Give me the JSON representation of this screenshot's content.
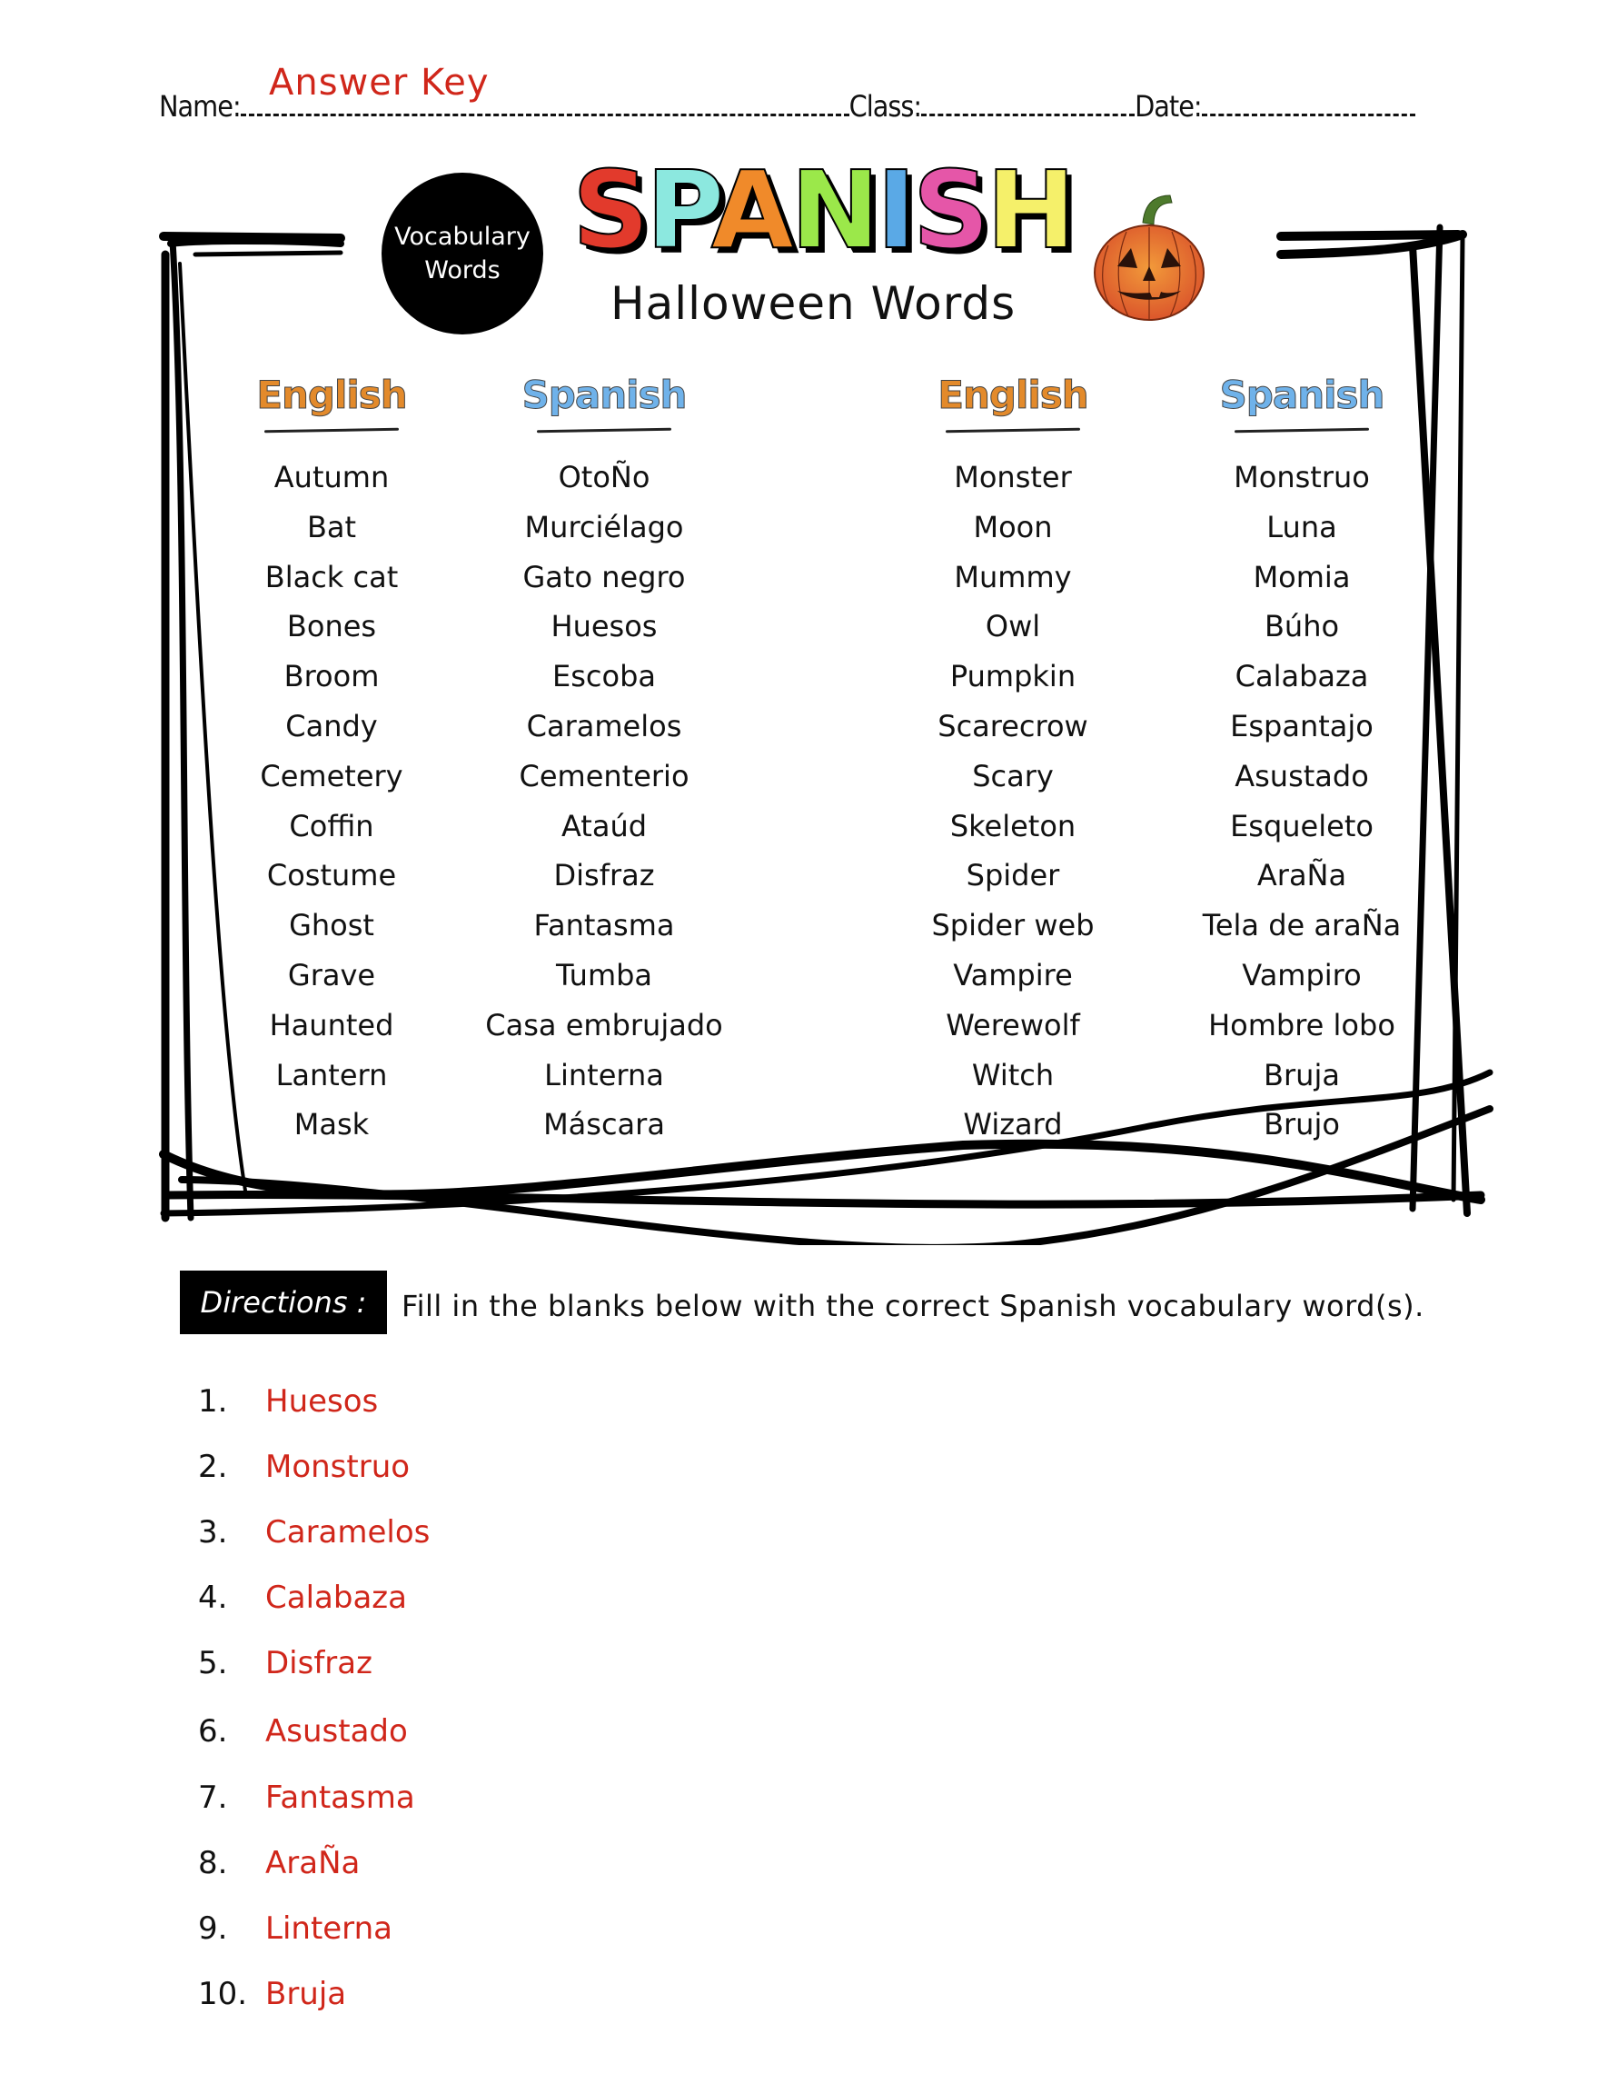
{
  "header": {
    "name_label": "Name:",
    "class_label": "Class:",
    "date_label": "Date:",
    "answer_key": "Answer Key"
  },
  "title": {
    "badge_line1": "Vocabulary",
    "badge_line2": "Words",
    "main_letters": [
      "S",
      "P",
      "A",
      "N",
      "I",
      "S",
      "H"
    ],
    "main_letter_colors": [
      "#e23a2c",
      "#8ce8df",
      "#f08a2a",
      "#9be84a",
      "#5aa9e6",
      "#e556a8",
      "#f5f06a"
    ],
    "subtitle": "Halloween Words",
    "pumpkin_icon": "jack-o-lantern-icon"
  },
  "vocabulary": {
    "headers": {
      "english": "English",
      "spanish": "Spanish"
    },
    "header_colors": {
      "english": "#e38a2b",
      "spanish": "#6fb2ea"
    },
    "left": {
      "english": [
        "Autumn",
        "Bat",
        "Black cat",
        "Bones",
        "Broom",
        "Candy",
        "Cemetery",
        "Coffin",
        "Costume",
        "Ghost",
        "Grave",
        "Haunted",
        "Lantern",
        "Mask"
      ],
      "spanish": [
        "OtoÑo",
        "Murciélago",
        "Gato negro",
        "Huesos",
        "Escoba",
        "Caramelos",
        "Cementerio",
        "Ataúd",
        "Disfraz",
        "Fantasma",
        "Tumba",
        "Casa embrujado",
        "Linterna",
        "Máscara"
      ]
    },
    "right": {
      "english": [
        "Monster",
        "Moon",
        "Mummy",
        "Owl",
        "Pumpkin",
        "Scarecrow",
        "Scary",
        "Skeleton",
        "Spider",
        "Spider web",
        "Vampire",
        "Werewolf",
        "Witch",
        "Wizard"
      ],
      "spanish": [
        "Monstruo",
        "Luna",
        "Momia",
        "Búho",
        "Calabaza",
        "Espantajo",
        "Asustado",
        "Esqueleto",
        "AraÑa",
        "Tela de araÑa",
        "Vampiro",
        "Hombre lobo",
        "Bruja",
        "Brujo"
      ]
    }
  },
  "directions": {
    "label": "Directions :",
    "text": "Fill in the blanks below with the correct Spanish vocabulary word(s)."
  },
  "answers": [
    {
      "num": "1.",
      "word": "Huesos"
    },
    {
      "num": "2.",
      "word": "Monstruo"
    },
    {
      "num": "3.",
      "word": "Caramelos"
    },
    {
      "num": "4.",
      "word": "Calabaza"
    },
    {
      "num": "5.",
      "word": "Disfraz"
    },
    {
      "num": "6.",
      "word": "Asustado"
    },
    {
      "num": "7.",
      "word": "Fantasma"
    },
    {
      "num": "8.",
      "word": "AraÑa"
    },
    {
      "num": "9.",
      "word": "Linterna"
    },
    {
      "num": "10.",
      "word": "Bruja"
    }
  ],
  "colors": {
    "answer_red": "#d0261a",
    "ink": "#111111"
  }
}
